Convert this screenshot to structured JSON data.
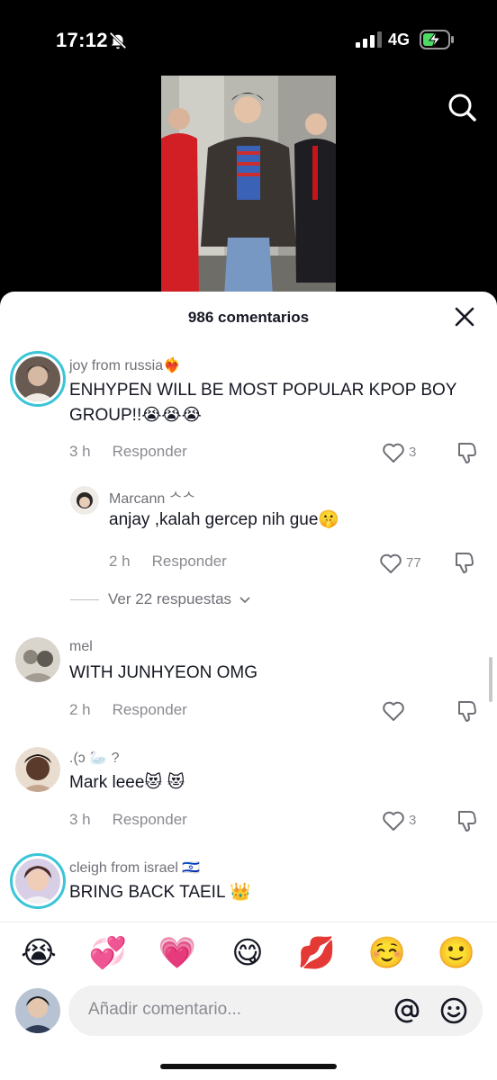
{
  "status_bar": {
    "time": "17:12",
    "network": "4G"
  },
  "sheet": {
    "title": "986 comentarios"
  },
  "comments": [
    {
      "username": "joy from russia❤️‍🔥",
      "text": "ENHYPEN WILL BE MOST POPULAR KPOP BOY GROUP!!😭😭😭",
      "time": "3 h",
      "reply_label": "Responder",
      "likes": "3"
    },
    {
      "username": "Marcann ᄉᄉ",
      "text": "anjay ,kalah gercep nih gue🤫",
      "time": "2 h",
      "reply_label": "Responder",
      "likes": "77"
    },
    {
      "username": "mel",
      "text": "WITH JUNHYEON OMG",
      "time": "2 h",
      "reply_label": "Responder",
      "likes": ""
    },
    {
      "username": ".(ↄ 🦢 ?",
      "text": "Mark leee😻 😻",
      "time": "3 h",
      "reply_label": "Responder",
      "likes": "3"
    },
    {
      "username": "cleigh from israel 🇮🇱",
      "text": "BRING BACK TAEIL 👑",
      "time": "",
      "reply_label": "",
      "likes": ""
    }
  ],
  "view_replies": "Ver 22 respuestas",
  "emoji_bar": [
    "😭",
    "💞",
    "💗",
    "😋",
    "💋",
    "☺️",
    "🙂"
  ],
  "input": {
    "placeholder": "Añadir comentario..."
  },
  "colors": {
    "accent_ring": "#3ac5d8",
    "sheet_bg": "#ffffff",
    "muted_text": "#8a8b91"
  }
}
